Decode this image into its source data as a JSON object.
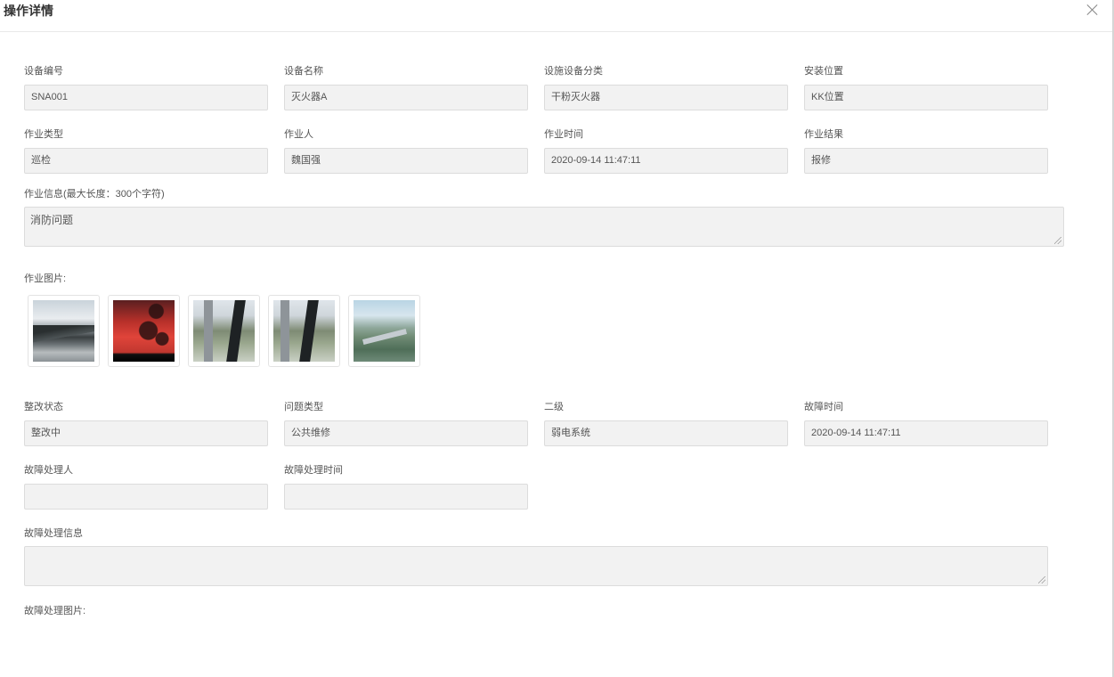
{
  "dialog": {
    "title": "操作详情",
    "close_icon": "close-icon"
  },
  "section1": {
    "fields": [
      {
        "label": "设备编号",
        "value": "SNA001"
      },
      {
        "label": "设备名称",
        "value": "灭火器A"
      },
      {
        "label": "设施设备分类",
        "value": "干粉灭火器"
      },
      {
        "label": "安装位置",
        "value": "KK位置"
      },
      {
        "label": "作业类型",
        "value": "巡检"
      },
      {
        "label": "作业人",
        "value": "魏国强"
      },
      {
        "label": "作业时间",
        "value": "2020-09-14 11:47:11"
      },
      {
        "label": "作业结果",
        "value": "报修"
      }
    ],
    "info_label": "作业信息(最大长度：300个字符)",
    "info_value": "消防问题",
    "images_label": "作业图片:",
    "images": [
      "photo-coast-thumbnail",
      "photo-sunset-tree-thumbnail",
      "photo-window-view-thumbnail",
      "photo-window-view-thumbnail",
      "photo-city-valley-thumbnail"
    ]
  },
  "section2": {
    "fields": [
      {
        "label": "整改状态",
        "value": "整改中"
      },
      {
        "label": "问题类型",
        "value": "公共维修"
      },
      {
        "label": "二级",
        "value": "弱电系统"
      },
      {
        "label": "故障时间",
        "value": "2020-09-14 11:47:11"
      },
      {
        "label": "故障处理人",
        "value": ""
      },
      {
        "label": "故障处理时间",
        "value": ""
      }
    ],
    "handle_info_label": "故障处理信息",
    "handle_info_value": "",
    "handle_images_label": "故障处理图片:"
  }
}
